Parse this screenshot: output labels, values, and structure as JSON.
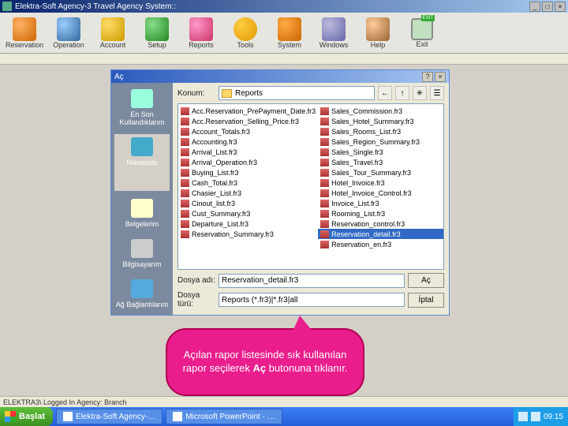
{
  "window": {
    "title": "Elektra-Soft Agency-3 Travel Agency System::"
  },
  "toolbar": {
    "items": [
      {
        "label": "Reservation",
        "cls": "reservation"
      },
      {
        "label": "Operation",
        "cls": "operation"
      },
      {
        "label": "Account",
        "cls": "account"
      },
      {
        "label": "Setup",
        "cls": "setup"
      },
      {
        "label": "Reports",
        "cls": "reports"
      },
      {
        "label": "Tools",
        "cls": "tools"
      },
      {
        "label": "System",
        "cls": "system"
      },
      {
        "label": "Windows",
        "cls": "windows"
      },
      {
        "label": "Help",
        "cls": "help"
      },
      {
        "label": "Exit",
        "cls": "exit"
      }
    ]
  },
  "dialog": {
    "title": "Aç",
    "look_in_label": "Konum:",
    "look_in_value": "Reports",
    "filename_label": "Dosya adı:",
    "filename_value": "Reservation_detail.fr3",
    "filetype_label": "Dosya türü:",
    "filetype_value": "Reports (*.fr3)|*.fr3|all",
    "open_btn": "Aç",
    "cancel_btn": "İptal",
    "places": [
      {
        "label": "En Son Kullandıklarım",
        "cls": "recent"
      },
      {
        "label": "Masaüstü",
        "cls": "desktop"
      },
      {
        "label": "Belgelerim",
        "cls": "docs"
      },
      {
        "label": "Bilgisayarım",
        "cls": "comp"
      },
      {
        "label": "Ağ Bağlantılarım",
        "cls": "fav"
      }
    ],
    "files_col1": [
      "Acc.Reservation_PrePayment_Date.fr3",
      "Acc.Reservation_Selling_Price.fr3",
      "Account_Totals.fr3",
      "Accounting.fr3",
      "Arrival_List.fr3",
      "Arrival_Operation.fr3",
      "Buying_List.fr3",
      "Cash_Total.fr3",
      "Chasier_List.fr3",
      "Cinout_list.fr3",
      "Cust_Summary.fr3",
      "Departure_List.fr3",
      "Reservation_Summary.fr3"
    ],
    "files_col2": [
      "Sales_Commission.fr3",
      "Sales_Hotel_Summary.fr3",
      "Sales_Rooms_List.fr3",
      "Sales_Region_Summary.fr3",
      "Sales_Single.fr3",
      "Sales_Travel.fr3",
      "Sales_Tour_Summary.fr3",
      "Hotel_Invoice.fr3",
      "Hotel_Invoice_Control.fr3",
      "Invoice_List.fr3",
      "Rooming_List.fr3",
      "Reservation_control.fr3",
      "Reservation_detail.fr3",
      "Reservation_en.fr3"
    ],
    "selected_index_col2": 12
  },
  "callout": {
    "text_before": "Açılan rapor listesinde sık kullanılan rapor seçilerek ",
    "bold": "Aç",
    "text_after": " butonuna tıklanır."
  },
  "statusbar": {
    "text": "ELEKTRA3\\ Logged In Agency: Branch"
  },
  "taskbar": {
    "start": "Başlat",
    "tasks": [
      "Elektra-Soft Agency-…",
      "Microsoft PowerPoint - …"
    ],
    "time": "09:15"
  }
}
